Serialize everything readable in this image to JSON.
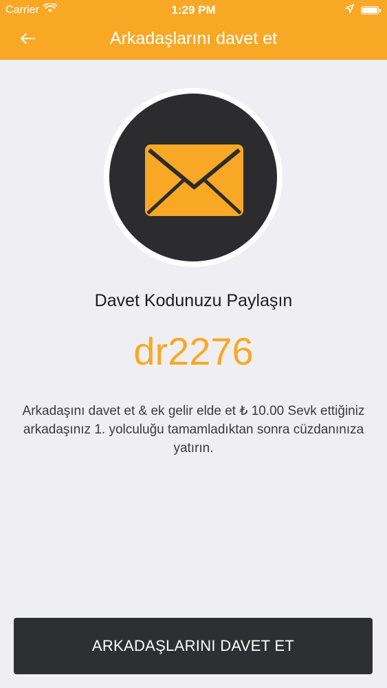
{
  "status_bar": {
    "carrier": "Carrier",
    "time": "1:29 PM",
    "icons": [
      "wifi-icon",
      "location-icon",
      "battery-icon"
    ]
  },
  "nav": {
    "title": "Arkadaşlarını davet et",
    "back_icon": "arrow-left-icon"
  },
  "hero": {
    "icon": "envelope-icon"
  },
  "main": {
    "share_title": "Davet Kodunuzu Paylaşın",
    "invite_code": "dr2276",
    "description": "Arkadaşını davet et & ek gelir elde et ₺ 10.00 Sevk ettiğiniz arkadaşınız 1. yolculuğu tamamladıktan sonra cüzdanınıza yatırın."
  },
  "cta": {
    "label": "ARKADAŞLARINI DAVET ET"
  },
  "colors": {
    "accent": "#f9a825",
    "dark": "#2e2f33",
    "background": "#efeff3"
  }
}
